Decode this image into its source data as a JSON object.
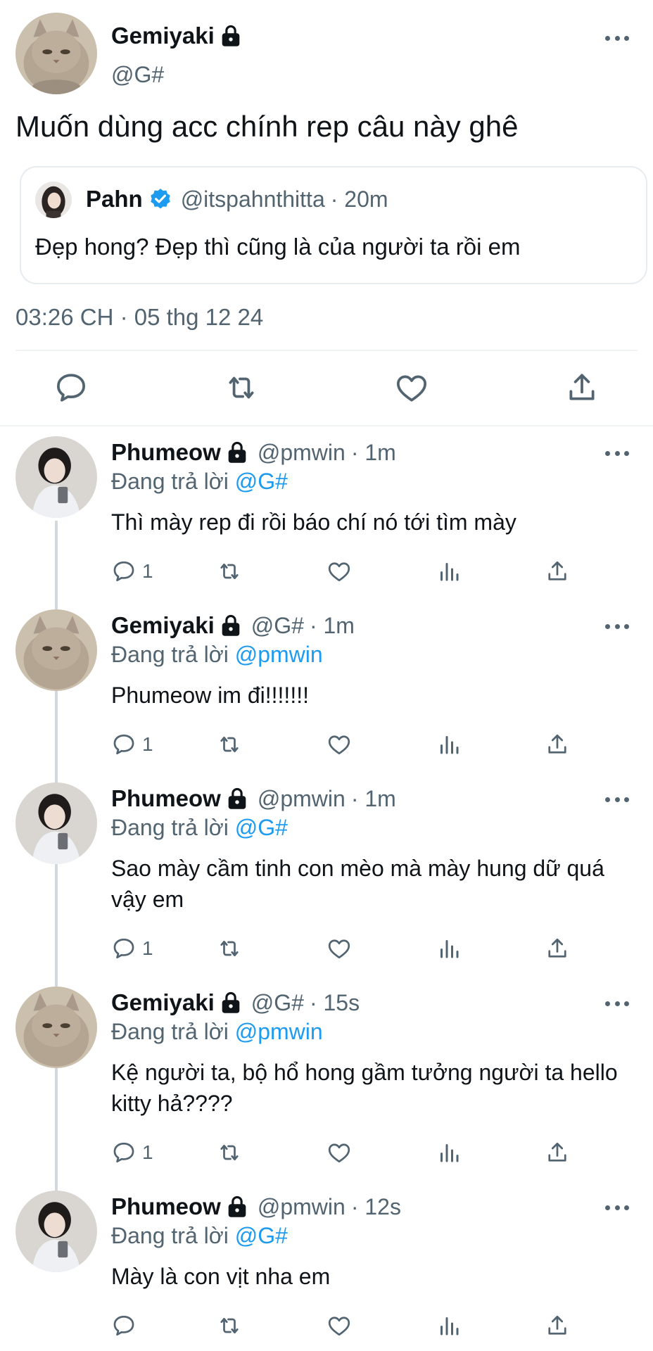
{
  "main_tweet": {
    "author_name": "Gemiyaki",
    "author_handle": "@G#",
    "text": "Muốn dùng acc chính rep câu này ghê",
    "quoted": {
      "author_name": "Pahn",
      "author_handle": "@itspahnthitta",
      "time": "· 20m",
      "text": "Đẹp hong? Đẹp thì cũng là của người ta rồi em"
    },
    "timestamp": "03:26 CH · 05 thg 12 24",
    "actions": [
      "reply-icon",
      "retweet-icon",
      "like-icon",
      "share-icon"
    ]
  },
  "replies": [
    {
      "author_name": "Phumeow",
      "author_handle": "@pmwin",
      "time": "· 1m",
      "replying_prefix": "Đang trả lời ",
      "replying_to": "@G#",
      "text": "Thì mày rep đi rồi báo chí nó tới tìm mày",
      "reply_count": "1"
    },
    {
      "author_name": "Gemiyaki",
      "author_handle": "@G#",
      "time": "· 1m",
      "replying_prefix": "Đang trả lời ",
      "replying_to": "@pmwin",
      "text": "Phumeow im đi!!!!!!!",
      "reply_count": "1"
    },
    {
      "author_name": "Phumeow",
      "author_handle": "@pmwin",
      "time": "· 1m",
      "replying_prefix": "Đang trả lời ",
      "replying_to": "@G#",
      "text": "Sao mày cầm tinh con mèo mà mày hung dữ quá vậy em",
      "reply_count": "1"
    },
    {
      "author_name": "Gemiyaki",
      "author_handle": "@G#",
      "time": "· 15s",
      "replying_prefix": "Đang trả lời ",
      "replying_to": "@pmwin",
      "text": "Kệ người ta, bộ hổ hong gầm tưởng người ta hello kitty hả????",
      "reply_count": "1"
    },
    {
      "author_name": "Phumeow",
      "author_handle": "@pmwin",
      "time": "· 12s",
      "replying_prefix": "Đang trả lời ",
      "replying_to": "@G#",
      "text": "Mày là con vịt nha em",
      "reply_count": ""
    }
  ],
  "colors": {
    "text": "#0f1419",
    "secondary": "#536471",
    "link": "#1d9bf0",
    "border": "#eff3f4"
  }
}
